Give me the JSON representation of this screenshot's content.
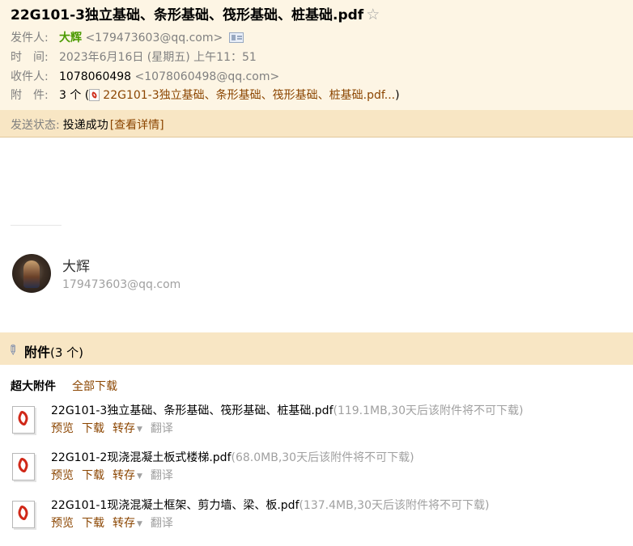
{
  "mail": {
    "subject": "22G101-3独立基础、条形基础、筏形基础、桩基础.pdf",
    "star_icon": "star-outline-icon",
    "from_label": "发件人:",
    "from_name": "大辉",
    "from_addr": "<179473603@qq.com>",
    "time_label": "时　间:",
    "time_value": "2023年6月16日 (星期五) 上午11：51",
    "to_label": "收件人:",
    "to_name": "1078060498",
    "to_addr": "<1078060498@qq.com>",
    "attach_label": "附　件:",
    "attach_count": "3 个 (",
    "attach_first": "22G101-3独立基础、条形基础、筏形基础、桩基础.pdf...",
    "attach_close": ")"
  },
  "status": {
    "label": "发送状态:",
    "value": "投递成功",
    "detail_link": "[查看详情]"
  },
  "signature": {
    "name": "大辉",
    "email": "179473603@qq.com"
  },
  "attachments": {
    "title": "附件",
    "count": "(3 个)",
    "big_label": "超大附件",
    "download_all": "全部下载",
    "actions": {
      "preview": "预览",
      "download": "下载",
      "forward": "转存",
      "translate": "翻译"
    },
    "files": [
      {
        "name": "22G101-3独立基础、条形基础、筏形基础、桩基础.pdf",
        "meta": "(119.1MB,30天后该附件将不可下载)"
      },
      {
        "name": "22G101-2现浇混凝土板式楼梯.pdf",
        "meta": "(68.0MB,30天后该附件将不可下载)"
      },
      {
        "name": "22G101-1现浇混凝土框架、剪力墙、梁、板.pdf",
        "meta": "(137.4MB,30天后该附件将不可下载)"
      }
    ]
  }
}
